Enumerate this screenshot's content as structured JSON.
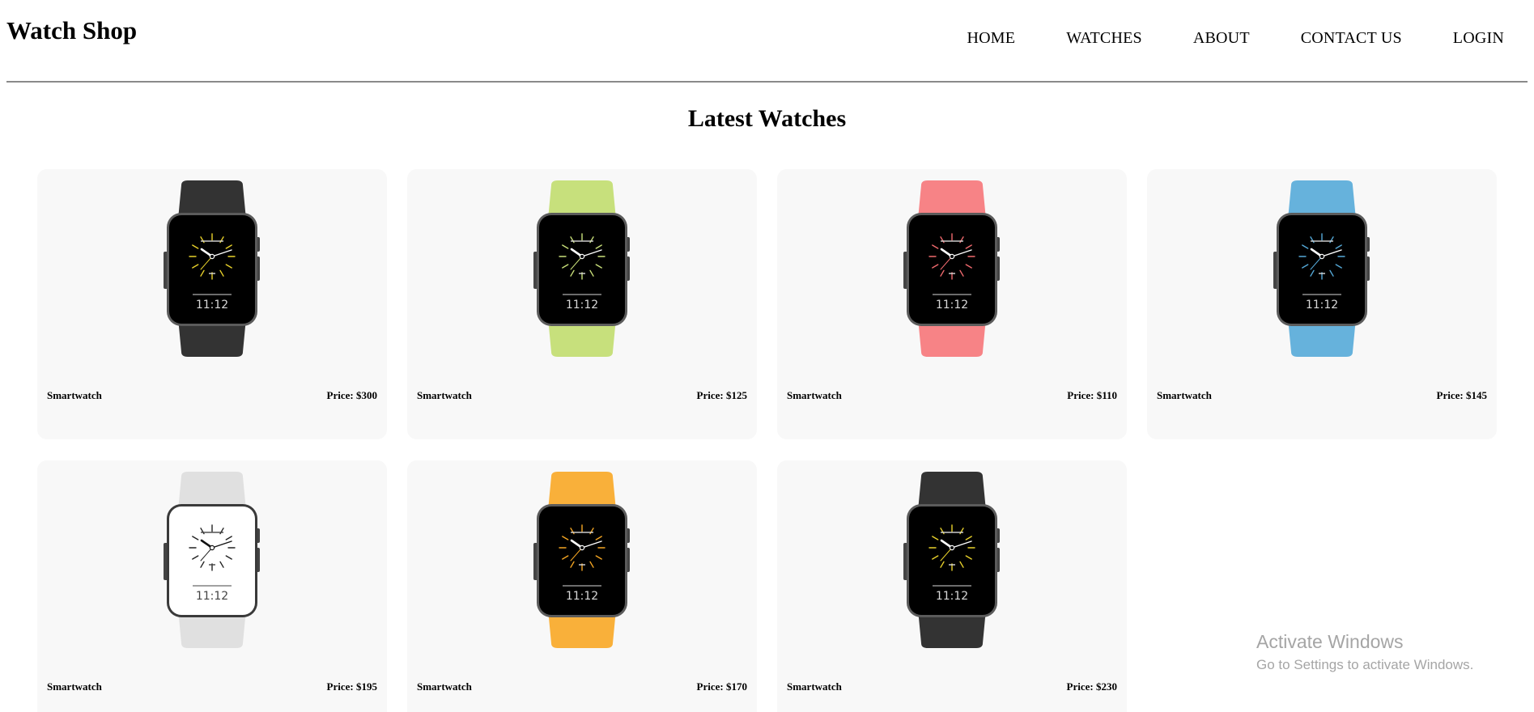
{
  "header": {
    "logo": "Watch Shop",
    "nav": [
      "HOME",
      "WATCHES",
      "ABOUT",
      "CONTACT US",
      "LOGIN"
    ]
  },
  "section_title": "Latest Watches",
  "products": [
    {
      "name": "Smartwatch",
      "price": "Price: $300",
      "band_color": "#333333",
      "face": "dark",
      "accent": "#e8d12a",
      "time": "11:12"
    },
    {
      "name": "Smartwatch",
      "price": "Price: $125",
      "band_color": "#c7e07c",
      "face": "dark",
      "accent": "#c9e07a",
      "time": "11:12"
    },
    {
      "name": "Smartwatch",
      "price": "Price: $110",
      "band_color": "#f78386",
      "face": "dark",
      "accent": "#f06a6e",
      "time": "11:12"
    },
    {
      "name": "Smartwatch",
      "price": "Price: $145",
      "band_color": "#66b2dc",
      "face": "dark",
      "accent": "#55a9d8",
      "time": "11:12"
    },
    {
      "name": "Smartwatch",
      "price": "Price: $195",
      "band_color": "#e0e0e0",
      "face": "light",
      "accent": "#222222",
      "time": "11:12"
    },
    {
      "name": "Smartwatch",
      "price": "Price: $170",
      "band_color": "#f9b03a",
      "face": "dark",
      "accent": "#f4a522",
      "time": "11:12"
    },
    {
      "name": "Smartwatch",
      "price": "Price: $230",
      "band_color": "#333333",
      "face": "dark",
      "accent": "#e8d12a",
      "time": "11:12"
    }
  ],
  "watermark": {
    "line1": "Activate Windows",
    "line2": "Go to Settings to activate Windows."
  }
}
